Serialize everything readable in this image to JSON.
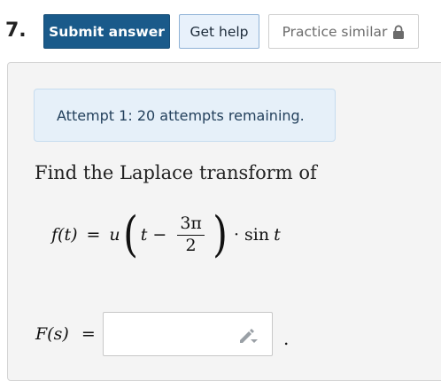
{
  "question": {
    "number": "7."
  },
  "toolbar": {
    "submit_label": "Submit answer",
    "help_label": "Get help",
    "practice_label": "Practice similar"
  },
  "attempt": {
    "text": "Attempt 1: 20 attempts remaining."
  },
  "problem": {
    "prompt": "Find the Laplace transform of",
    "f_lhs": "f(t)",
    "equals": "=",
    "u": "u",
    "t": "t",
    "minus": "−",
    "frac_num": "3π",
    "frac_den": "2",
    "dot": "·",
    "sin": "sin",
    "t2": "t"
  },
  "answer": {
    "label": "F(s)",
    "equals": "=",
    "value": "",
    "period": "."
  },
  "colors": {
    "submit_bg": "#1a5a8a",
    "help_bg": "#e8f1fb",
    "attempt_bg": "#e6f0f9"
  }
}
